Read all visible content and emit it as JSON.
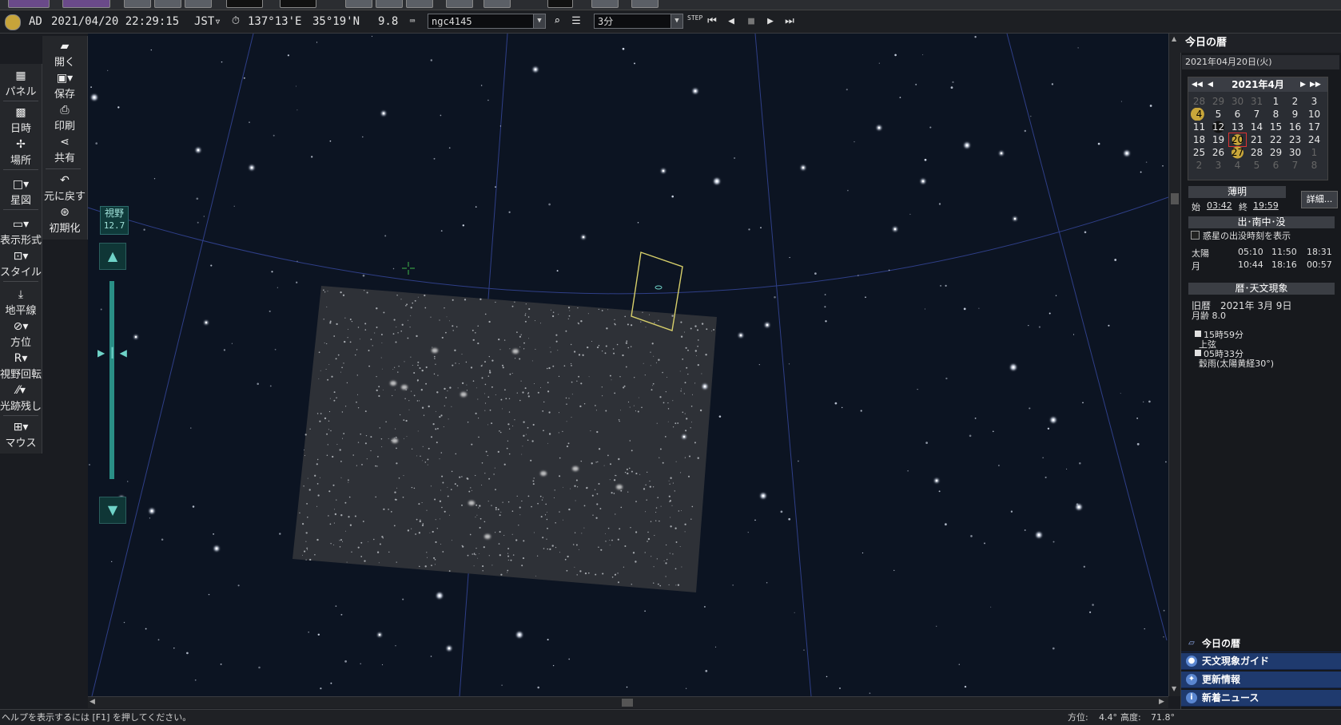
{
  "status": {
    "era": "AD",
    "datetime": "2021/04/20 22:29:15",
    "timezone": "JST▿",
    "longitude": "137°13'E",
    "latitude": "35°19'N",
    "altitude": "9.8",
    "search_value": "ngc4145",
    "step_value": "3分",
    "step_badge": "STEP"
  },
  "left_toolbar": {
    "panel": "パネル",
    "datetime": "日時",
    "location": "場所",
    "star_map": "星図",
    "display_format": "表示形式",
    "style": "スタイル",
    "horizon": "地平線",
    "direction": "方位",
    "view_rotation": "視野回転",
    "trail": "光跡残し",
    "mouse": "マウス"
  },
  "file_toolbar": {
    "open": "開く",
    "save": "保存",
    "print": "印刷",
    "share": "共有",
    "undo": "元に戻す",
    "reset": "初期化"
  },
  "fov": {
    "label": "視野",
    "value": "12.7"
  },
  "almanac": {
    "title": "今日の暦",
    "date": "2021年04月20日(火)",
    "calendar_month": "2021年4月",
    "weeks": [
      [
        "28",
        "29",
        "30",
        "31",
        "1",
        "2",
        "3"
      ],
      [
        "4",
        "5",
        "6",
        "7",
        "8",
        "9",
        "10"
      ],
      [
        "11",
        "12",
        "13",
        "14",
        "15",
        "16",
        "17"
      ],
      [
        "18",
        "19",
        "20",
        "21",
        "22",
        "23",
        "24"
      ],
      [
        "25",
        "26",
        "27",
        "28",
        "29",
        "30",
        "1"
      ],
      [
        "2",
        "3",
        "4",
        "5",
        "6",
        "7",
        "8"
      ]
    ],
    "twilight_head": "薄明",
    "twilight_start_label": "始",
    "twilight_start": "03:42",
    "twilight_end_label": "終",
    "twilight_end": "19:59",
    "details_button": "詳細...",
    "rise_head": "出･南中･没",
    "planet_times_label": "惑星の出没時刻を表示",
    "sun_label": "太陽",
    "sun_rise": "05:10",
    "sun_transit": "11:50",
    "sun_set": "18:31",
    "moon_label": "月",
    "moon_rise": "10:44",
    "moon_transit": "18:16",
    "moon_set": "00:57",
    "events_head": "暦･天文現象",
    "lunar_date": "旧暦　2021年 3月 9日",
    "moon_age": "月齢 8.0",
    "event1_time": "15時59分",
    "event1_name": "上弦",
    "event2_time": "05時33分",
    "event2_name": "穀雨(太陽黄経30°)"
  },
  "news": {
    "today": "今日の暦",
    "guide": "天文現象ガイド",
    "updates": "更新情報",
    "news": "新着ニュース"
  },
  "bottom": {
    "help": "ヘルプを表示するには [F1] を押してください。",
    "azimuth_label": "方位:",
    "azimuth": "4.4°",
    "altitude_label": "高度:",
    "altitude": "71.8°"
  }
}
